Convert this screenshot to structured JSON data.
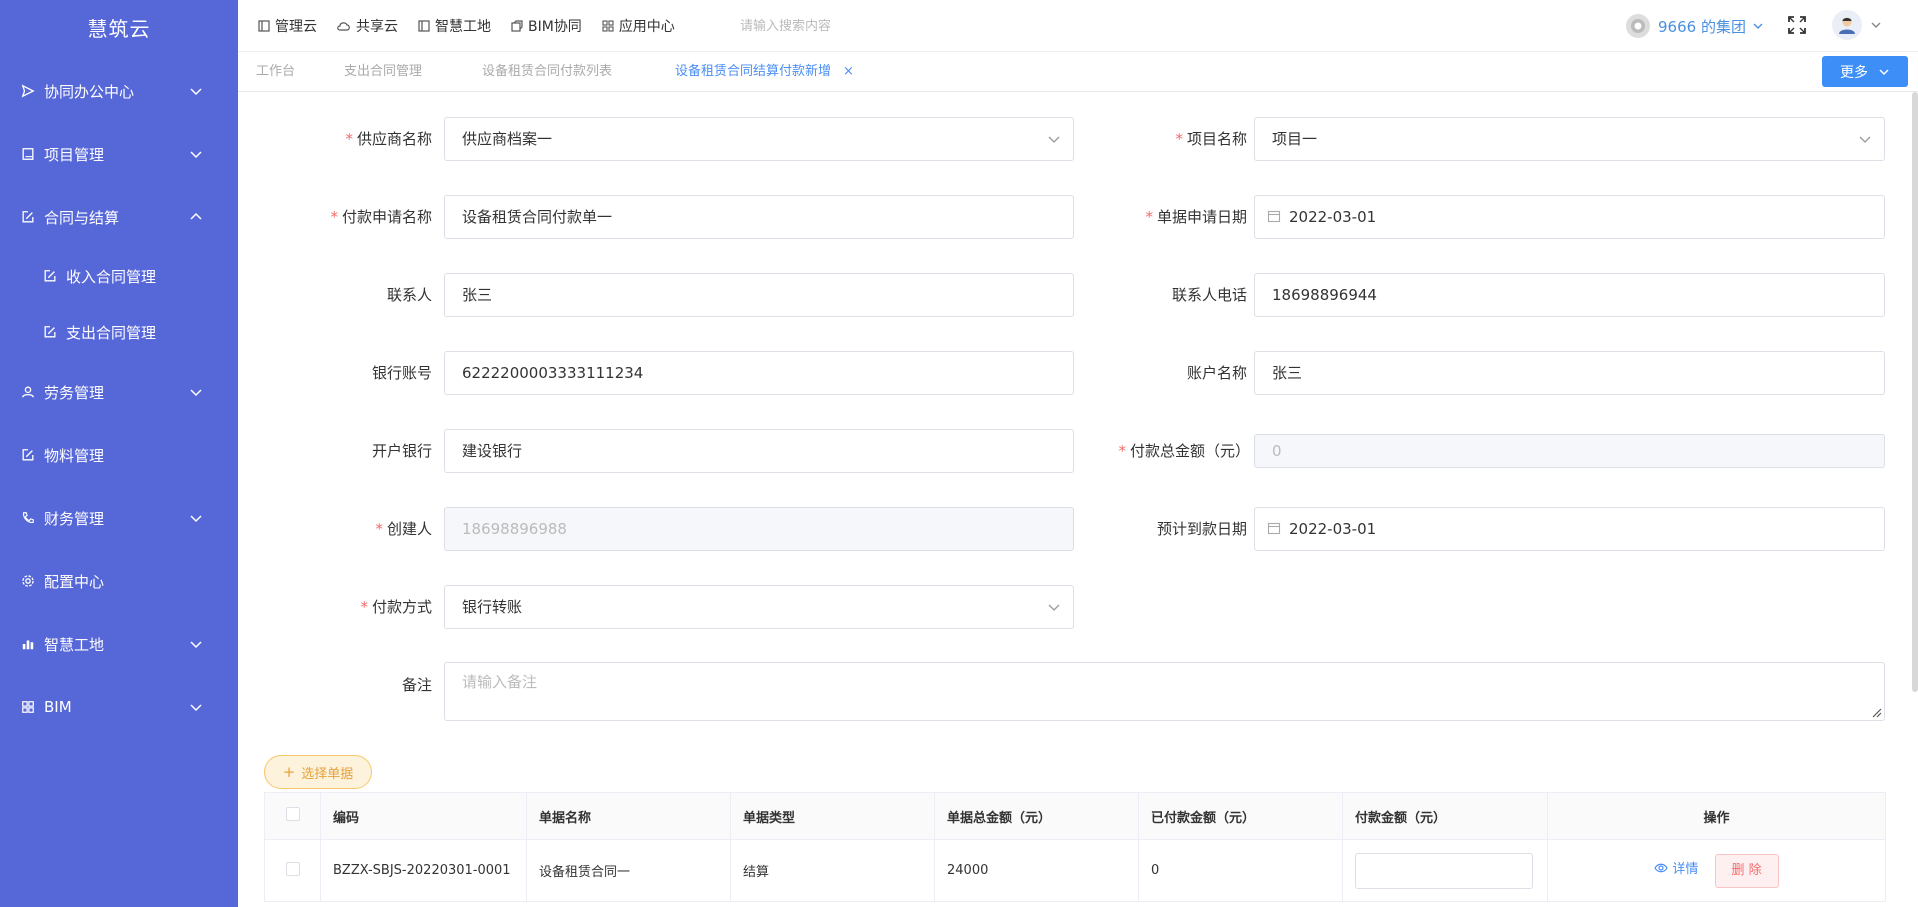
{
  "app": {
    "logo": "慧筑云"
  },
  "sidebar": {
    "items": [
      {
        "label": "协同办公中心",
        "icon": "send-icon",
        "expandable": true,
        "expanded": false
      },
      {
        "label": "项目管理",
        "icon": "book-icon",
        "expandable": true,
        "expanded": false
      },
      {
        "label": "合同与结算",
        "icon": "edit-icon",
        "expandable": true,
        "expanded": true
      },
      {
        "label": "收入合同管理",
        "icon": "edit-icon",
        "sub": true
      },
      {
        "label": "支出合同管理",
        "icon": "edit-icon",
        "sub": true
      },
      {
        "label": "劳务管理",
        "icon": "user-icon",
        "expandable": true,
        "expanded": false
      },
      {
        "label": "物料管理",
        "icon": "edit-icon",
        "expandable": false
      },
      {
        "label": "财务管理",
        "icon": "phone-icon",
        "expandable": true,
        "expanded": false
      },
      {
        "label": "配置中心",
        "icon": "gear-icon",
        "expandable": false
      },
      {
        "label": "智慧工地",
        "icon": "bar-chart-icon",
        "expandable": true,
        "expanded": false
      },
      {
        "label": "BIM",
        "icon": "grid-icon",
        "expandable": true,
        "expanded": false
      }
    ]
  },
  "topbar": {
    "nav": [
      {
        "label": "管理云",
        "icon": "panel-icon"
      },
      {
        "label": "共享云",
        "icon": "cloud-icon"
      },
      {
        "label": "智慧工地",
        "icon": "panel-icon"
      },
      {
        "label": "BIM协同",
        "icon": "cube-icon"
      },
      {
        "label": "应用中心",
        "icon": "grid-icon"
      }
    ],
    "search_placeholder": "请输入搜索内容",
    "org": "9666 的集团"
  },
  "tabs": [
    {
      "label": "工作台",
      "active": false
    },
    {
      "label": "支出合同管理",
      "active": false
    },
    {
      "label": "设备租赁合同付款列表",
      "active": false
    },
    {
      "label": "设备租赁合同结算付款新增",
      "active": true,
      "closable": true
    }
  ],
  "more_label": "更多",
  "form": {
    "supplier": {
      "label": "供应商名称",
      "value": "供应商档案一",
      "required": true
    },
    "project": {
      "label": "项目名称",
      "value": "项目一",
      "required": true
    },
    "pay_name": {
      "label": "付款申请名称",
      "value": "设备租赁合同付款单一",
      "required": true
    },
    "apply_date": {
      "label": "单据申请日期",
      "value": "2022-03-01",
      "required": true
    },
    "contact": {
      "label": "联系人",
      "value": "张三"
    },
    "contact_phone": {
      "label": "联系人电话",
      "value": "18698896944"
    },
    "bank_account": {
      "label": "银行账号",
      "value": "6222200003333111234"
    },
    "account_name": {
      "label": "账户名称",
      "value": "张三"
    },
    "bank": {
      "label": "开户银行",
      "value": "建设银行"
    },
    "total": {
      "label": "付款总金额（元）",
      "value": "0",
      "required": true
    },
    "creator": {
      "label": "创建人",
      "value": "18698896988",
      "required": true
    },
    "expected_date": {
      "label": "预计到款日期",
      "value": "2022-03-01"
    },
    "pay_method": {
      "label": "付款方式",
      "value": "银行转账",
      "required": true
    },
    "remark": {
      "label": "备注",
      "placeholder": "请输入备注"
    }
  },
  "pick_button": "选择单据",
  "table": {
    "headers": [
      "编码",
      "单据名称",
      "单据类型",
      "单据总金额（元）",
      "已付款金额（元）",
      "付款金额（元）",
      "操作"
    ],
    "rows": [
      {
        "code": "BZZX-SBJS-20220301-0001",
        "name": "设备租赁合同一",
        "type": "结算",
        "total": "24000",
        "paid": "0"
      }
    ],
    "detail_label": "详情",
    "delete_label": "删 除"
  }
}
